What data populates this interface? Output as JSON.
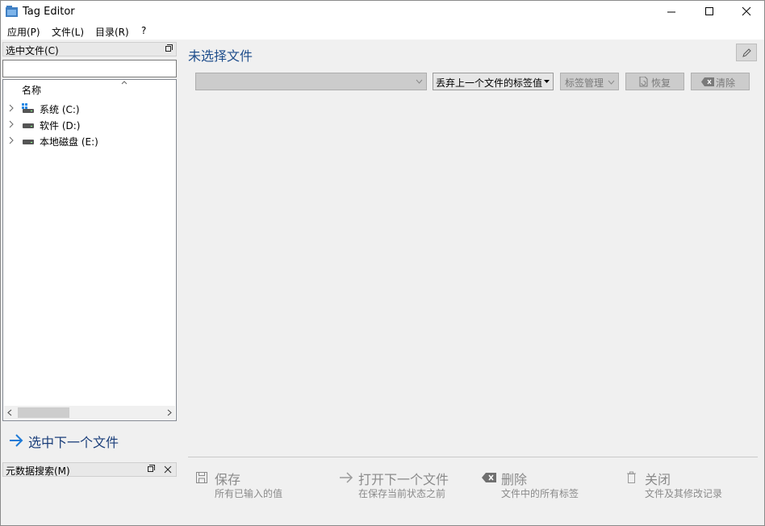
{
  "window": {
    "title": "Tag Editor"
  },
  "menu": {
    "items": [
      "应用(P)",
      "文件(L)",
      "目录(R)",
      "?"
    ]
  },
  "file_panel": {
    "title": "选中文件(C)",
    "filter_value": "",
    "column_header": "名称",
    "drives": [
      {
        "label": "系统 (C:)",
        "icon": "system-drive-icon"
      },
      {
        "label": "软件 (D:)",
        "icon": "drive-icon"
      },
      {
        "label": "本地磁盘 (E:)",
        "icon": "drive-icon"
      }
    ]
  },
  "next_file_link": "选中下一个文件",
  "metadata_panel": {
    "title": "元数据搜索(M)"
  },
  "main": {
    "title": "未选择文件",
    "toolbar": {
      "tag_combo_value": "",
      "discard_label": "丢弃上一个文件的标签值",
      "tag_manage_label": "标签管理",
      "restore_label": "恢复",
      "clear_label": "清除"
    }
  },
  "actions": [
    {
      "label": "保存",
      "sub": "所有已输入的值",
      "icon": "save-icon"
    },
    {
      "label": "打开下一个文件",
      "sub": "在保存当前状态之前",
      "icon": "arrow-right-icon"
    },
    {
      "label": "删除",
      "sub": "文件中的所有标签",
      "icon": "backspace-icon"
    },
    {
      "label": "关闭",
      "sub": "文件及其修改记录",
      "icon": "trash-icon"
    }
  ],
  "colors": {
    "accent_text": "#1f4e8c",
    "disabled_text": "#8a8a8a",
    "link_arrow": "#1e7ad6"
  }
}
